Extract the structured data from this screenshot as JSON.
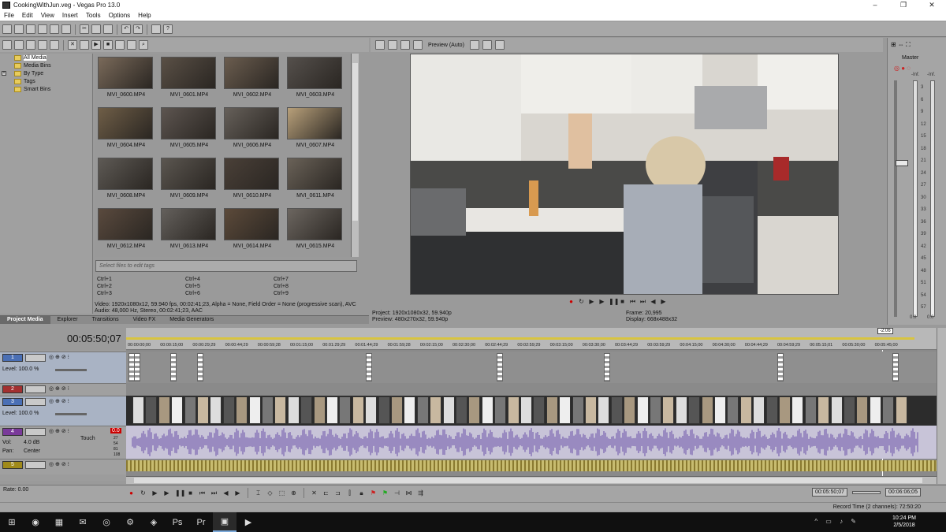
{
  "window": {
    "title": "CookingWithJun.veg - Vegas Pro 13.0",
    "controls": [
      "–",
      "❐",
      "✕"
    ]
  },
  "menu": [
    "File",
    "Edit",
    "View",
    "Insert",
    "Tools",
    "Options",
    "Help"
  ],
  "tree": [
    {
      "label": "All Media",
      "selected": true
    },
    {
      "label": "Media Bins"
    },
    {
      "label": "By Type",
      "expandable": true
    },
    {
      "label": "Tags"
    },
    {
      "label": "Smart Bins"
    }
  ],
  "media_files": [
    "MVI_0600.MP4",
    "MVI_0601.MP4",
    "MVI_0602.MP4",
    "MVI_0603.MP4",
    "MVI_0604.MP4",
    "MVI_0605.MP4",
    "MVI_0606.MP4",
    "MVI_0607.MP4",
    "MVI_0608.MP4",
    "MVI_0609.MP4",
    "MVI_0610.MP4",
    "MVI_0611.MP4",
    "MVI_0612.MP4",
    "MVI_0613.MP4",
    "MVI_0614.MP4",
    "MVI_0615.MP4"
  ],
  "tags_placeholder": "Select files to edit tags",
  "tag_shortcuts": [
    "Ctrl+1",
    "Ctrl+4",
    "Ctrl+7",
    "Ctrl+2",
    "Ctrl+5",
    "Ctrl+8",
    "Ctrl+3",
    "Ctrl+6",
    "Ctrl+9"
  ],
  "media_info": {
    "video": "Video: 1920x1080x12, 59.940 fps, 00:02:41;23, Alpha = None, Field Order = None (progressive scan), AVC",
    "audio": "Audio: 48,000 Hz, Stereo, 00:02:41;23, AAC"
  },
  "left_tabs": [
    "Project Media",
    "Explorer",
    "Transitions",
    "Video FX",
    "Media Generators"
  ],
  "preview": {
    "mode_label": "Preview (Auto)",
    "project_label": "Project:",
    "project_value": "1920x1080x32, 59.940p",
    "preview_label": "Preview:",
    "preview_value": "480x270x32, 59.940p",
    "frame_label": "Frame:",
    "frame_value": "20,995",
    "display_label": "Display:",
    "display_value": "668x488x32"
  },
  "master": {
    "label": "Master",
    "top_labels": [
      "-Inf.",
      "-Inf."
    ],
    "scale": [
      "3",
      "6",
      "9",
      "12",
      "15",
      "18",
      "21",
      "24",
      "27",
      "30",
      "33",
      "36",
      "39",
      "42",
      "45",
      "48",
      "51",
      "54",
      "57"
    ],
    "bottom_labels": [
      "0.0",
      "0.0"
    ]
  },
  "timeline": {
    "timecode": "00:05:50;07",
    "ruler": [
      "00:00:00;00",
      "00:00:15;00",
      "00:00:29;29",
      "00:00:44;29",
      "00:00:59;28",
      "00:01:15;00",
      "00:01:29;29",
      "00:01:44;29",
      "00:01:59;28",
      "00:02:15;00",
      "00:02:30;00",
      "00:02:44;29",
      "00:02:59;29",
      "00:03:15;00",
      "00:03:30;00",
      "00:03:44;29",
      "00:03:59;29",
      "00:04:15;00",
      "00:04:30;00",
      "00:04:44;29",
      "00:04:59;29",
      "00:05:15;01",
      "00:05:30;00",
      "00:05:45;00"
    ],
    "end_marker": "-2:06",
    "tracks": [
      {
        "num": "1",
        "color": "#4a6fb5",
        "type": "video",
        "level": "Level: 100.0 %"
      },
      {
        "num": "2",
        "color": "#a33030",
        "type": "video",
        "level": ""
      },
      {
        "num": "3",
        "color": "#4a6fb5",
        "type": "video",
        "level": "Level: 100.0 %"
      },
      {
        "num": "4",
        "color": "#7a3a9a",
        "type": "audio",
        "vol_label": "Vol:",
        "vol": "4.0 dB",
        "pan_label": "Pan:",
        "pan": "Center",
        "mode": "Touch",
        "peak": "0.0",
        "meter": [
          "27",
          "54",
          "81",
          "108"
        ]
      },
      {
        "num": "5",
        "color": "#a08a1a",
        "type": "audio"
      }
    ]
  },
  "bottom": {
    "rate": "Rate: 0.00",
    "cursor_tc": "00:05:50;07",
    "length_tc": "00:06:06;05",
    "record_time": "Record Time (2 channels): 72:50:20"
  },
  "taskbar": {
    "time": "10:24 PM",
    "date": "2/5/2018",
    "apps": [
      "⊞",
      "◉",
      "▦",
      "✉",
      "◎",
      "⚙",
      "◈",
      "Ps",
      "Pr",
      "▣",
      "▶"
    ]
  }
}
